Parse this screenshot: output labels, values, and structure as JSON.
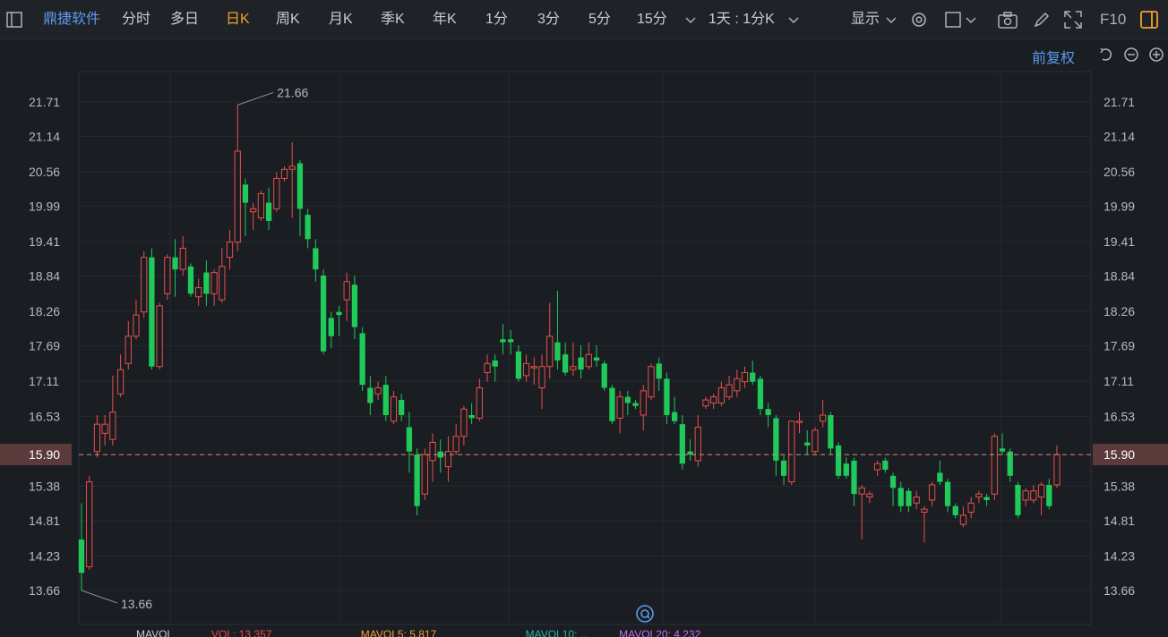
{
  "toolbar": {
    "stock_name": "鼎捷软件",
    "tabs": [
      "分时",
      "多日",
      "日K",
      "周K",
      "月K",
      "季K",
      "年K",
      "1分",
      "3分",
      "5分",
      "15分"
    ],
    "active_tab": "日K",
    "period_select": "1天 : 1分K",
    "display_label": "显示",
    "f10_label": "F10"
  },
  "adjust_label": "前复权",
  "colors": {
    "up": "#e8504b",
    "down": "#1fc95a",
    "accent": "#f0a22e",
    "link": "#5b9bf0",
    "background": "#1a1d22"
  },
  "chart_data": {
    "type": "candlestick",
    "y_ticks": [
      "21.71",
      "21.14",
      "20.56",
      "19.99",
      "19.41",
      "18.84",
      "18.26",
      "17.69",
      "17.11",
      "16.53",
      "15.90",
      "15.38",
      "14.81",
      "14.23",
      "13.66"
    ],
    "ylim": [
      13.66,
      21.71
    ],
    "current_price": "15.90",
    "high_annotation": "21.66",
    "low_annotation": "13.66",
    "candles": [
      {
        "o": 14.5,
        "c": 13.95,
        "h": 15.1,
        "l": 13.66
      },
      {
        "o": 14.05,
        "c": 15.45,
        "h": 15.55,
        "l": 14.0
      },
      {
        "o": 15.95,
        "c": 16.4,
        "h": 16.55,
        "l": 15.85
      },
      {
        "o": 16.25,
        "c": 16.4,
        "h": 16.55,
        "l": 16.05
      },
      {
        "o": 16.15,
        "c": 16.6,
        "h": 17.2,
        "l": 16.05
      },
      {
        "o": 16.9,
        "c": 17.3,
        "h": 17.55,
        "l": 16.85
      },
      {
        "o": 17.4,
        "c": 17.85,
        "h": 18.1,
        "l": 17.3
      },
      {
        "o": 17.85,
        "c": 18.2,
        "h": 18.45,
        "l": 17.8
      },
      {
        "o": 18.25,
        "c": 19.15,
        "h": 19.25,
        "l": 18.15
      },
      {
        "o": 19.15,
        "c": 17.35,
        "h": 19.3,
        "l": 17.3
      },
      {
        "o": 17.35,
        "c": 18.35,
        "h": 18.4,
        "l": 17.3
      },
      {
        "o": 18.55,
        "c": 19.15,
        "h": 19.2,
        "l": 18.45
      },
      {
        "o": 19.15,
        "c": 18.95,
        "h": 19.45,
        "l": 18.5
      },
      {
        "o": 18.95,
        "c": 19.3,
        "h": 19.5,
        "l": 18.85
      },
      {
        "o": 19.0,
        "c": 18.55,
        "h": 19.05,
        "l": 18.5
      },
      {
        "o": 18.5,
        "c": 18.65,
        "h": 18.8,
        "l": 18.35
      },
      {
        "o": 18.9,
        "c": 18.55,
        "h": 19.1,
        "l": 18.35
      },
      {
        "o": 18.55,
        "c": 18.9,
        "h": 18.95,
        "l": 18.35
      },
      {
        "o": 18.45,
        "c": 19.0,
        "h": 19.3,
        "l": 18.4
      },
      {
        "o": 19.15,
        "c": 19.4,
        "h": 19.6,
        "l": 18.95
      },
      {
        "o": 19.4,
        "c": 20.9,
        "h": 21.66,
        "l": 19.25
      },
      {
        "o": 20.35,
        "c": 20.05,
        "h": 20.45,
        "l": 19.5
      },
      {
        "o": 19.9,
        "c": 19.95,
        "h": 20.05,
        "l": 19.6
      },
      {
        "o": 19.8,
        "c": 20.2,
        "h": 20.25,
        "l": 19.75
      },
      {
        "o": 20.05,
        "c": 19.75,
        "h": 20.3,
        "l": 19.6
      },
      {
        "o": 19.95,
        "c": 20.45,
        "h": 20.55,
        "l": 19.9
      },
      {
        "o": 20.45,
        "c": 20.6,
        "h": 20.65,
        "l": 20.4
      },
      {
        "o": 20.6,
        "c": 20.65,
        "h": 21.05,
        "l": 19.8
      },
      {
        "o": 20.7,
        "c": 19.95,
        "h": 20.75,
        "l": 19.5
      },
      {
        "o": 19.85,
        "c": 19.45,
        "h": 19.95,
        "l": 19.3
      },
      {
        "o": 19.3,
        "c": 18.95,
        "h": 19.45,
        "l": 18.75
      },
      {
        "o": 18.85,
        "c": 17.6,
        "h": 18.95,
        "l": 17.55
      },
      {
        "o": 18.15,
        "c": 17.85,
        "h": 18.25,
        "l": 17.65
      },
      {
        "o": 18.25,
        "c": 18.2,
        "h": 18.35,
        "l": 17.85
      },
      {
        "o": 18.45,
        "c": 18.75,
        "h": 18.9,
        "l": 18.1
      },
      {
        "o": 18.7,
        "c": 18.0,
        "h": 18.85,
        "l": 17.8
      },
      {
        "o": 17.9,
        "c": 17.05,
        "h": 18.0,
        "l": 16.95
      },
      {
        "o": 17.0,
        "c": 16.75,
        "h": 17.2,
        "l": 16.55
      },
      {
        "o": 16.9,
        "c": 17.0,
        "h": 17.1,
        "l": 16.8
      },
      {
        "o": 17.05,
        "c": 16.55,
        "h": 17.2,
        "l": 16.45
      },
      {
        "o": 16.45,
        "c": 16.85,
        "h": 16.95,
        "l": 16.4
      },
      {
        "o": 16.8,
        "c": 16.55,
        "h": 16.9,
        "l": 16.45
      },
      {
        "o": 16.35,
        "c": 15.95,
        "h": 16.6,
        "l": 15.6
      },
      {
        "o": 15.9,
        "c": 15.05,
        "h": 16.0,
        "l": 14.9
      },
      {
        "o": 15.25,
        "c": 15.9,
        "h": 16.0,
        "l": 15.15
      },
      {
        "o": 15.8,
        "c": 16.1,
        "h": 16.25,
        "l": 15.45
      },
      {
        "o": 15.95,
        "c": 15.85,
        "h": 16.15,
        "l": 15.6
      },
      {
        "o": 15.7,
        "c": 15.95,
        "h": 16.2,
        "l": 15.45
      },
      {
        "o": 15.95,
        "c": 16.2,
        "h": 16.4,
        "l": 15.9
      },
      {
        "o": 16.2,
        "c": 16.65,
        "h": 16.7,
        "l": 16.05
      },
      {
        "o": 16.55,
        "c": 16.5,
        "h": 16.75,
        "l": 16.4
      },
      {
        "o": 16.5,
        "c": 17.0,
        "h": 17.15,
        "l": 16.45
      },
      {
        "o": 17.25,
        "c": 17.4,
        "h": 17.55,
        "l": 17.1
      },
      {
        "o": 17.45,
        "c": 17.35,
        "h": 17.55,
        "l": 17.1
      },
      {
        "o": 17.8,
        "c": 17.75,
        "h": 18.05,
        "l": 17.55
      },
      {
        "o": 17.8,
        "c": 17.75,
        "h": 17.95,
        "l": 17.55
      },
      {
        "o": 17.6,
        "c": 17.15,
        "h": 17.7,
        "l": 17.1
      },
      {
        "o": 17.2,
        "c": 17.4,
        "h": 17.55,
        "l": 17.1
      },
      {
        "o": 17.35,
        "c": 17.35,
        "h": 17.5,
        "l": 17.05
      },
      {
        "o": 17.0,
        "c": 17.35,
        "h": 17.55,
        "l": 16.65
      },
      {
        "o": 17.35,
        "c": 17.85,
        "h": 18.4,
        "l": 17.15
      },
      {
        "o": 17.75,
        "c": 17.45,
        "h": 18.6,
        "l": 17.3
      },
      {
        "o": 17.55,
        "c": 17.25,
        "h": 17.75,
        "l": 17.2
      },
      {
        "o": 17.3,
        "c": 17.35,
        "h": 17.75,
        "l": 17.2
      },
      {
        "o": 17.5,
        "c": 17.3,
        "h": 17.7,
        "l": 17.15
      },
      {
        "o": 17.35,
        "c": 17.55,
        "h": 17.75,
        "l": 17.3
      },
      {
        "o": 17.5,
        "c": 17.45,
        "h": 17.7,
        "l": 17.35
      },
      {
        "o": 17.4,
        "c": 17.0,
        "h": 17.45,
        "l": 16.95
      },
      {
        "o": 17.0,
        "c": 16.45,
        "h": 17.05,
        "l": 16.4
      },
      {
        "o": 16.5,
        "c": 16.85,
        "h": 16.95,
        "l": 16.25
      },
      {
        "o": 16.85,
        "c": 16.75,
        "h": 16.95,
        "l": 16.55
      },
      {
        "o": 16.75,
        "c": 16.7,
        "h": 16.8,
        "l": 16.65
      },
      {
        "o": 16.55,
        "c": 16.95,
        "h": 17.05,
        "l": 16.3
      },
      {
        "o": 16.85,
        "c": 17.35,
        "h": 17.4,
        "l": 16.8
      },
      {
        "o": 17.4,
        "c": 17.15,
        "h": 17.5,
        "l": 16.95
      },
      {
        "o": 17.15,
        "c": 16.55,
        "h": 17.25,
        "l": 16.4
      },
      {
        "o": 16.6,
        "c": 16.45,
        "h": 16.85,
        "l": 16.4
      },
      {
        "o": 16.4,
        "c": 15.75,
        "h": 16.55,
        "l": 15.65
      },
      {
        "o": 15.95,
        "c": 15.9,
        "h": 16.15,
        "l": 15.8
      },
      {
        "o": 15.8,
        "c": 16.35,
        "h": 16.55,
        "l": 15.7
      },
      {
        "o": 16.7,
        "c": 16.8,
        "h": 16.85,
        "l": 16.65
      },
      {
        "o": 16.75,
        "c": 16.85,
        "h": 16.9,
        "l": 16.65
      },
      {
        "o": 16.75,
        "c": 17.0,
        "h": 17.1,
        "l": 16.7
      },
      {
        "o": 16.85,
        "c": 17.05,
        "h": 17.2,
        "l": 16.8
      },
      {
        "o": 16.95,
        "c": 17.15,
        "h": 17.3,
        "l": 16.85
      },
      {
        "o": 17.1,
        "c": 17.25,
        "h": 17.35,
        "l": 17.0
      },
      {
        "o": 17.25,
        "c": 17.1,
        "h": 17.45,
        "l": 17.05
      },
      {
        "o": 17.15,
        "c": 16.65,
        "h": 17.2,
        "l": 16.55
      },
      {
        "o": 16.65,
        "c": 16.55,
        "h": 16.75,
        "l": 16.35
      },
      {
        "o": 16.5,
        "c": 15.8,
        "h": 16.55,
        "l": 15.55
      },
      {
        "o": 15.8,
        "c": 15.55,
        "h": 15.9,
        "l": 15.4
      },
      {
        "o": 15.45,
        "c": 16.45,
        "h": 16.45,
        "l": 15.4
      },
      {
        "o": 16.45,
        "c": 16.45,
        "h": 16.6,
        "l": 16.25
      },
      {
        "o": 16.1,
        "c": 16.05,
        "h": 16.3,
        "l": 15.9
      },
      {
        "o": 15.95,
        "c": 16.3,
        "h": 16.35,
        "l": 15.9
      },
      {
        "o": 16.45,
        "c": 16.55,
        "h": 16.8,
        "l": 16.35
      },
      {
        "o": 16.55,
        "c": 16.0,
        "h": 16.6,
        "l": 15.9
      },
      {
        "o": 16.05,
        "c": 15.55,
        "h": 16.1,
        "l": 15.5
      },
      {
        "o": 15.75,
        "c": 15.55,
        "h": 15.85,
        "l": 15.5
      },
      {
        "o": 15.8,
        "c": 15.25,
        "h": 15.85,
        "l": 15.05
      },
      {
        "o": 15.25,
        "c": 15.35,
        "h": 15.4,
        "l": 14.5
      },
      {
        "o": 15.2,
        "c": 15.25,
        "h": 15.3,
        "l": 15.1
      },
      {
        "o": 15.65,
        "c": 15.75,
        "h": 15.8,
        "l": 15.55
      },
      {
        "o": 15.8,
        "c": 15.65,
        "h": 15.85,
        "l": 15.6
      },
      {
        "o": 15.55,
        "c": 15.35,
        "h": 15.6,
        "l": 15.05
      },
      {
        "o": 15.35,
        "c": 15.05,
        "h": 15.45,
        "l": 14.95
      },
      {
        "o": 15.3,
        "c": 15.05,
        "h": 15.35,
        "l": 14.95
      },
      {
        "o": 15.1,
        "c": 15.2,
        "h": 15.3,
        "l": 15.0
      },
      {
        "o": 14.95,
        "c": 15.0,
        "h": 15.05,
        "l": 14.45
      },
      {
        "o": 15.15,
        "c": 15.4,
        "h": 15.45,
        "l": 15.05
      },
      {
        "o": 15.6,
        "c": 15.45,
        "h": 15.8,
        "l": 15.4
      },
      {
        "o": 15.45,
        "c": 15.05,
        "h": 15.5,
        "l": 14.95
      },
      {
        "o": 15.05,
        "c": 14.9,
        "h": 15.1,
        "l": 14.85
      },
      {
        "o": 14.75,
        "c": 14.9,
        "h": 15.05,
        "l": 14.7
      },
      {
        "o": 14.95,
        "c": 15.1,
        "h": 15.2,
        "l": 14.85
      },
      {
        "o": 15.2,
        "c": 15.25,
        "h": 15.3,
        "l": 15.1
      },
      {
        "o": 15.2,
        "c": 15.15,
        "h": 15.25,
        "l": 15.05
      },
      {
        "o": 15.25,
        "c": 16.2,
        "h": 16.25,
        "l": 15.15
      },
      {
        "o": 16.0,
        "c": 15.95,
        "h": 16.25,
        "l": 15.9
      },
      {
        "o": 15.95,
        "c": 15.55,
        "h": 16.0,
        "l": 15.45
      },
      {
        "o": 15.4,
        "c": 14.9,
        "h": 15.45,
        "l": 14.85
      },
      {
        "o": 15.15,
        "c": 15.3,
        "h": 15.35,
        "l": 15.05
      },
      {
        "o": 15.15,
        "c": 15.3,
        "h": 15.4,
        "l": 15.1
      },
      {
        "o": 15.2,
        "c": 15.4,
        "h": 15.45,
        "l": 14.9
      },
      {
        "o": 15.4,
        "c": 15.05,
        "h": 15.5,
        "l": 15.0
      },
      {
        "o": 15.4,
        "c": 15.9,
        "h": 16.05,
        "l": 15.35
      }
    ]
  },
  "bottom_legend": {
    "ma_label": "MAVOL",
    "vol_label": "VOL: 13.357",
    "mavol5_label": "MAVOL5: 5.817",
    "mavol10_label": "MAVOL10: ...",
    "mavol20_label": "MAVOL20: 4.232"
  }
}
